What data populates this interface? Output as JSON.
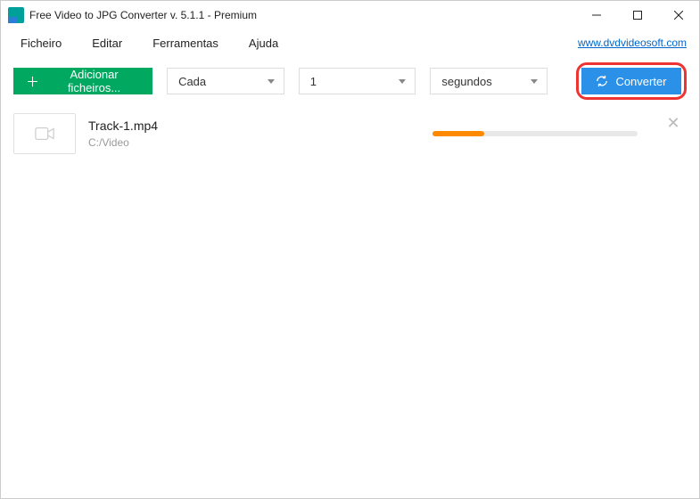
{
  "window": {
    "title": "Free Video to JPG Converter v. 5.1.1 - Premium"
  },
  "menu": {
    "items": [
      "Ficheiro",
      "Editar",
      "Ferramentas",
      "Ajuda"
    ],
    "site_link": "www.dvdvideosoft.com"
  },
  "toolbar": {
    "add_label": "Adicionar ficheiros...",
    "mode_label": "Cada",
    "interval_value": "1",
    "unit_label": "segundos",
    "convert_label": "Converter"
  },
  "files": [
    {
      "name": "Track-1.mp4",
      "path": "C:/Video",
      "progress_percent": 25
    }
  ]
}
